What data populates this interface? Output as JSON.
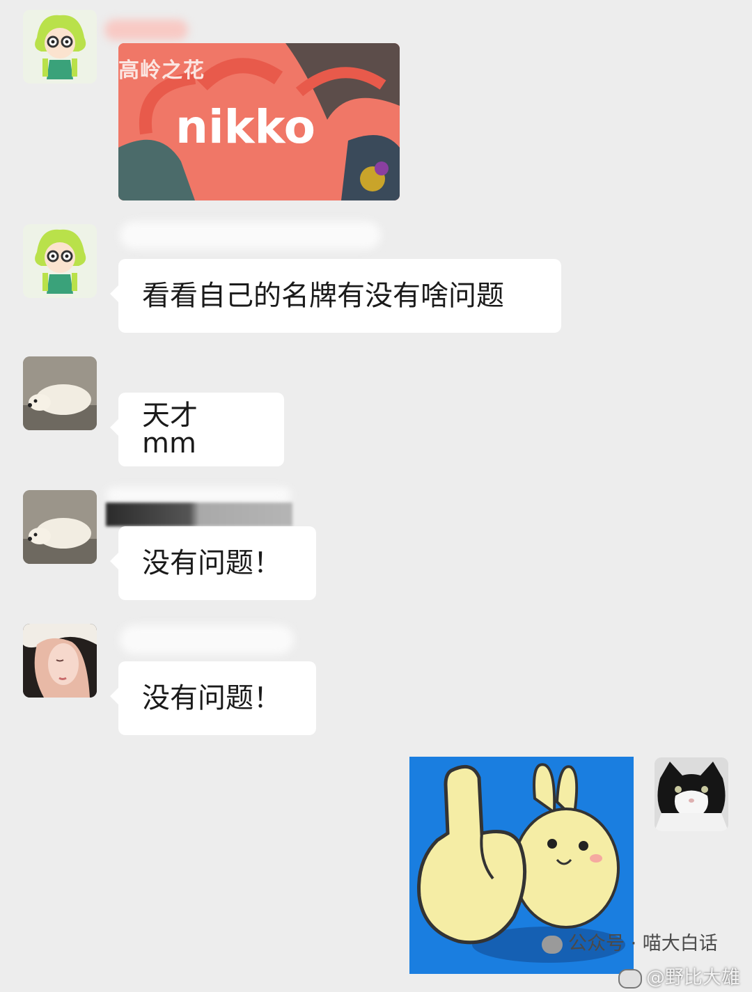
{
  "messages": [
    {
      "sender_avatar": "girl-avatar",
      "type": "image",
      "image": {
        "top_text": "高岭之花",
        "name": "nikko"
      }
    },
    {
      "sender_avatar": "girl-avatar",
      "type": "text",
      "text": "看看自己的名牌有没有啥问题"
    },
    {
      "sender_avatar": "dog-avatar",
      "type": "text",
      "text": "天才 mm"
    },
    {
      "sender_avatar": "dog-avatar",
      "type": "text",
      "text": "没有问题！"
    },
    {
      "sender_avatar": "anime-girl-avatar",
      "type": "text",
      "text": "没有问题！"
    },
    {
      "sender_avatar": "cat-avatar",
      "type": "sticker",
      "sticker": "bunny-middle-finger-sticker"
    }
  ],
  "watermark": {
    "official_account": "公众号 · 喵大白话",
    "weibo": "@野比大雄"
  },
  "colors": {
    "background": "#ededed",
    "bubble": "#ffffff",
    "card_red": "#f07767",
    "sticker_blue": "#1a7ee0"
  }
}
